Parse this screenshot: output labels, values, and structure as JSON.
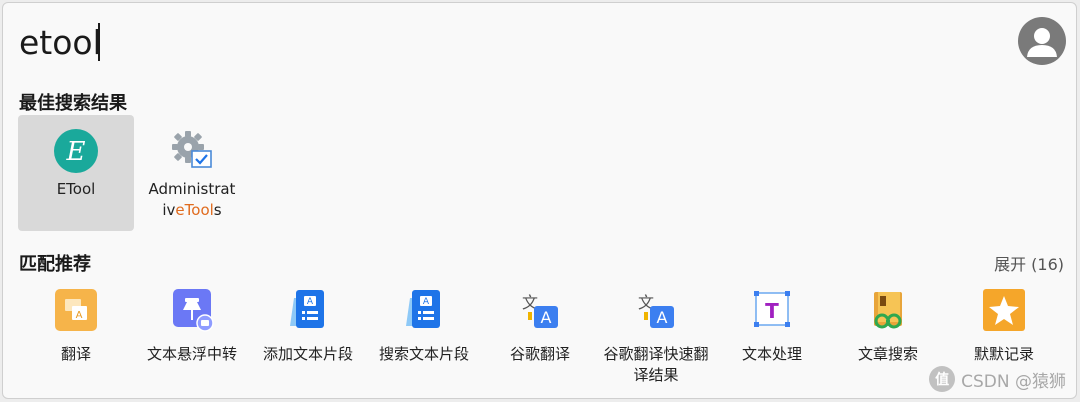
{
  "search": {
    "value": "etool"
  },
  "best": {
    "title": "最佳搜索结果",
    "items": [
      {
        "label": "ETool",
        "icon": "etool-app-icon",
        "selected": true
      },
      {
        "label_line1": "Administrat",
        "label_pre": "iv",
        "label_hl": "eTool",
        "label_post": "s",
        "icon": "gear-checkbox-icon"
      }
    ]
  },
  "match": {
    "title": "匹配推荐",
    "expand_label": "展开 (16)",
    "items": [
      {
        "label": "翻译",
        "icon": "translate-icon"
      },
      {
        "label": "文本悬浮中转",
        "icon": "pin-icon"
      },
      {
        "label": "添加文本片段",
        "icon": "text-snippet-add-icon"
      },
      {
        "label": "搜索文本片段",
        "icon": "text-snippet-search-icon"
      },
      {
        "label": "谷歌翻译",
        "icon": "google-translate-icon"
      },
      {
        "label": "谷歌翻译快速翻译结果",
        "icon": "google-translate-quick-icon"
      },
      {
        "label": "文本处理",
        "icon": "text-processing-icon"
      },
      {
        "label": "文章搜索",
        "icon": "article-search-icon"
      },
      {
        "label": "默默记录",
        "icon": "star-record-icon"
      }
    ]
  },
  "watermark": {
    "text": "CSDN @猿狮",
    "logo": "值"
  },
  "colors": {
    "highlight": "#e06b1e",
    "selected_bg": "#d9d9d9",
    "accent_blue": "#1e74e8"
  }
}
